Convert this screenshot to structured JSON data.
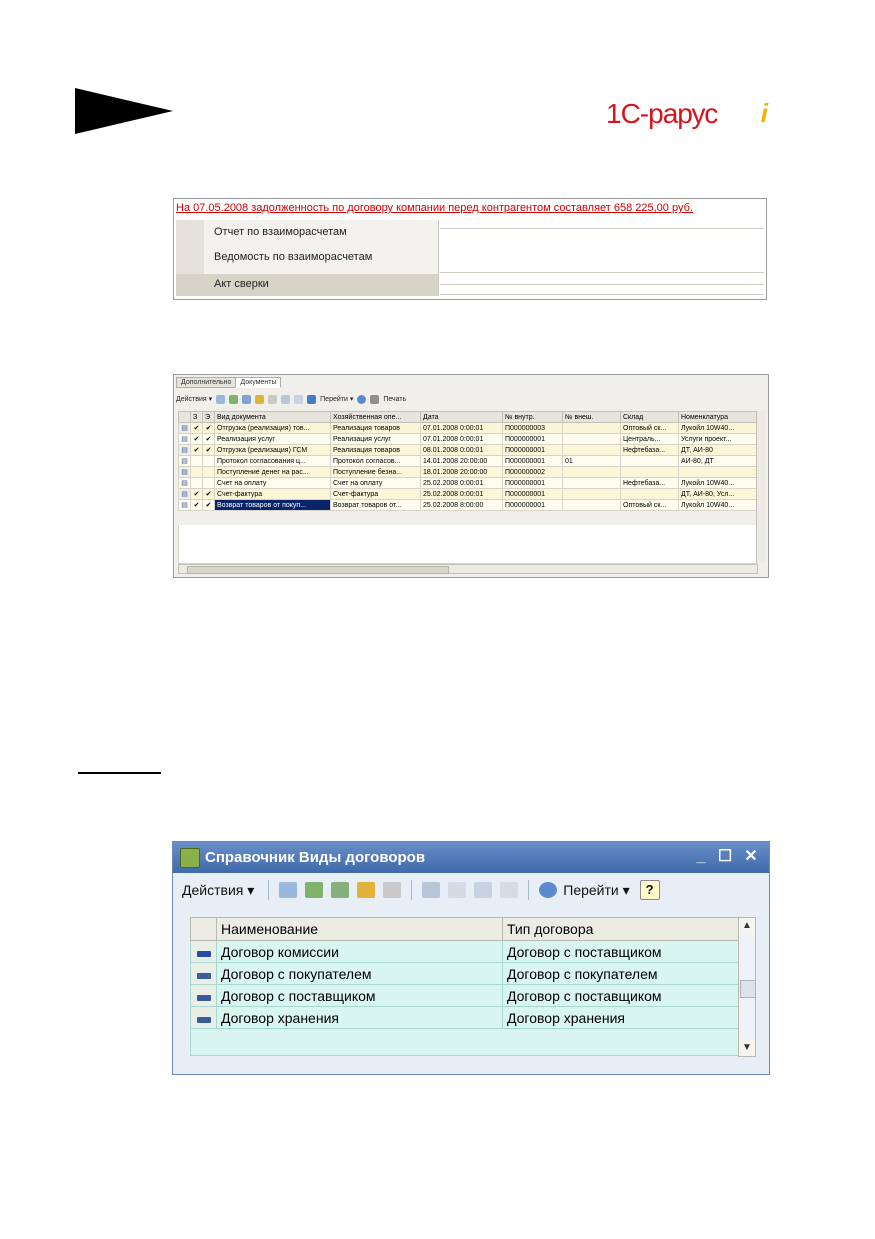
{
  "logo": {
    "text": "1С-рарус",
    "mark": "i"
  },
  "menu_shot": {
    "warning": "На 07.05.2008 задолженность по договору компании перед контрагентом составляет 658 225,00 руб.",
    "items": [
      "Отчет по взаиморасчетам",
      "Ведомость по взаиморасчетам",
      "Акт сверки"
    ]
  },
  "docs_shot": {
    "tabs": [
      "Дополнительно",
      "Документы"
    ],
    "toolbar": {
      "actions": "Действия ▾",
      "go": "Перейти ▾",
      "print": "Печать"
    },
    "columns": [
      "",
      "З",
      "Э",
      "Вид документа",
      "Хозяйственная опе...",
      "Дата",
      "№ внутр.",
      "№ внеш.",
      "Склад",
      "Номенклатура"
    ],
    "rows": [
      {
        "z": "✔",
        "e": "✔",
        "kind": "Отгрузка (реализация) тов...",
        "op": "Реализация товаров",
        "date": "07.01.2008 0:00:01",
        "num": "П000000003",
        "ext": "",
        "stock": "Оптовый ск...",
        "item": "Лукойл 10W40..."
      },
      {
        "z": "✔",
        "e": "✔",
        "kind": "Реализация услуг",
        "op": "Реализация услуг",
        "date": "07.01.2008 0:00:01",
        "num": "П000000001",
        "ext": "",
        "stock": "Централь...",
        "item": "Услуги проект..."
      },
      {
        "z": "✔",
        "e": "✔",
        "kind": "Отгрузка (реализация) ГСМ",
        "op": "Реализация товаров",
        "date": "08.01.2008 0:00:01",
        "num": "П000000001",
        "ext": "",
        "stock": "Нефтебаза...",
        "item": "ДТ, АИ-80"
      },
      {
        "z": "",
        "e": "",
        "kind": "Протокол согласования ц...",
        "op": "Протокол согласов...",
        "date": "14.01.2008 20:00:00",
        "num": "П000000001",
        "ext": "01",
        "stock": "",
        "item": "АИ-80, ДТ"
      },
      {
        "z": "",
        "e": "",
        "kind": "Поступление денег на рас...",
        "op": "Поступление безна...",
        "date": "18.01.2008 20:00:00",
        "num": "П000000002",
        "ext": "",
        "stock": "",
        "item": ""
      },
      {
        "z": "",
        "e": "",
        "kind": "Счет на оплату",
        "op": "Счет на оплату",
        "date": "25.02.2008 0:00:01",
        "num": "П000000001",
        "ext": "",
        "stock": "Нефтебаза...",
        "item": "Лукойл 10W40..."
      },
      {
        "z": "✔",
        "e": "✔",
        "kind": "Счет-фактура",
        "op": "Счет-фактура",
        "date": "25.02.2008 0:00:01",
        "num": "П000000001",
        "ext": "",
        "stock": "",
        "item": "ДТ, АИ-80, Усл..."
      },
      {
        "z": "✔",
        "e": "✔",
        "kind": "Возврат товаров от покуп...",
        "op": "Возврат товаров от...",
        "date": "25.02.2008 8:00:00",
        "num": "П000000001",
        "ext": "",
        "stock": "Оптовый ск...",
        "item": "Лукойл 10W40..."
      }
    ]
  },
  "window_shot": {
    "title": "Справочник Виды договоров",
    "buttons": {
      "minimize": "_",
      "maximize": "☐",
      "close": "✕"
    },
    "toolbar": {
      "actions": "Действия ▾",
      "go": "Перейти ▾",
      "help": "?"
    },
    "columns": [
      "Наименование",
      "Тип договора"
    ],
    "rows": [
      {
        "name": "Договор комиссии",
        "type": "Договор с поставщиком"
      },
      {
        "name": "Договор с покупателем",
        "type": "Договор с покупателем"
      },
      {
        "name": "Договор с поставщиком",
        "type": "Договор с поставщиком"
      },
      {
        "name": "Договор хранения",
        "type": "Договор хранения"
      }
    ]
  }
}
